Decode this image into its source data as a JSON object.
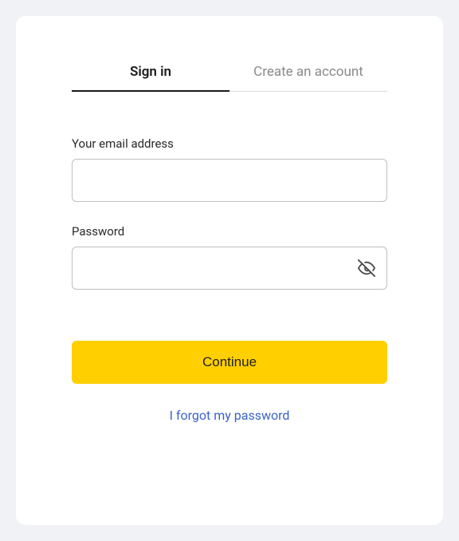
{
  "tabs": {
    "signin": "Sign in",
    "create": "Create an account"
  },
  "form": {
    "email_label": "Your email address",
    "email_value": "",
    "password_label": "Password",
    "password_value": "",
    "continue_label": "Continue",
    "forgot_label": "I forgot my password"
  },
  "colors": {
    "accent": "#ffcf00",
    "link": "#3a62c8"
  }
}
